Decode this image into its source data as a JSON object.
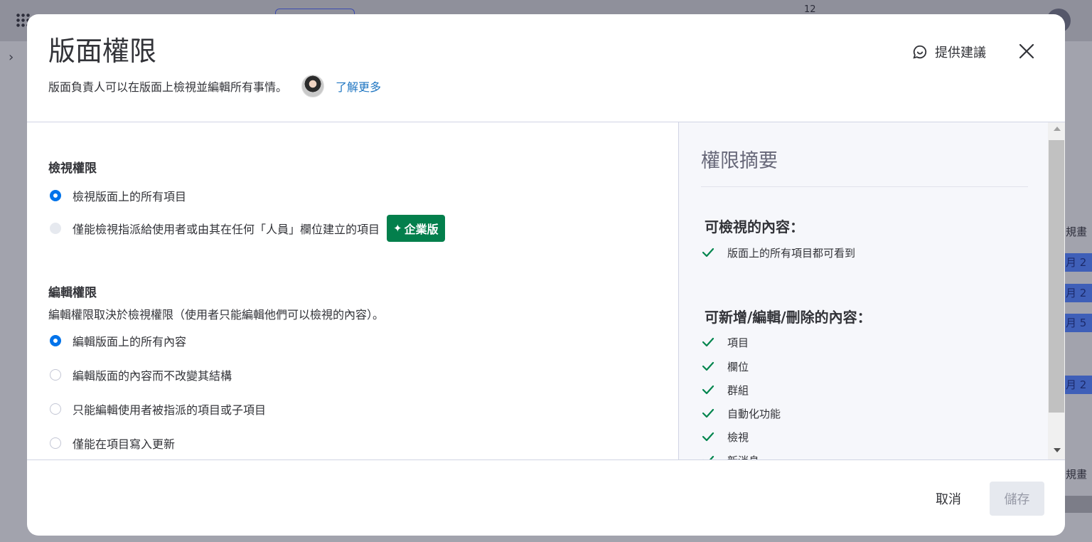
{
  "background": {
    "top_number": "12",
    "side_labels": [
      "規畫",
      "月 2",
      "月 2",
      "月 5",
      "月 2",
      "規畫"
    ]
  },
  "modal": {
    "title": "版面權限",
    "subtitle": "版面負責人可以在版面上檢視並編輯所有事情。",
    "learn_more": "了解更多",
    "feedback_label": "提供建議"
  },
  "view_permissions": {
    "title": "檢視權限",
    "options": [
      {
        "label": "檢視版面上的所有項目",
        "selected": true
      },
      {
        "label": "僅能檢視指派給使用者或由其在任何「人員」欄位建立的項目",
        "selected": false,
        "disabled": true
      }
    ],
    "enterprise_badge": "企業版",
    "enterprise_icon": "sparkle-icon"
  },
  "edit_permissions": {
    "title": "編輯權限",
    "description": "編輯權限取決於檢視權限（使用者只能編輯他們可以檢視的內容）。",
    "options": [
      {
        "label": "編輯版面上的所有內容",
        "selected": true
      },
      {
        "label": "編輯版面的內容而不改變其結構",
        "selected": false
      },
      {
        "label": "只能編輯使用者被指派的項目或子項目",
        "selected": false
      },
      {
        "label": "僅能在項目寫入更新",
        "selected": false
      }
    ]
  },
  "summary": {
    "title": "權限摘要",
    "viewable_heading": "可檢視的內容：",
    "viewable_items": [
      "版面上的所有項目都可看到"
    ],
    "editable_heading": "可新增/編輯/刪除的內容：",
    "editable_items": [
      "項目",
      "欄位",
      "群組",
      "自動化功能",
      "檢視",
      "新消息"
    ]
  },
  "footer": {
    "cancel_label": "取消",
    "save_label": "儲存"
  },
  "colors": {
    "accent": "#0073ea",
    "enterprise_green": "#037f4c",
    "check_green": "#00854d",
    "link": "#1f76c2"
  }
}
